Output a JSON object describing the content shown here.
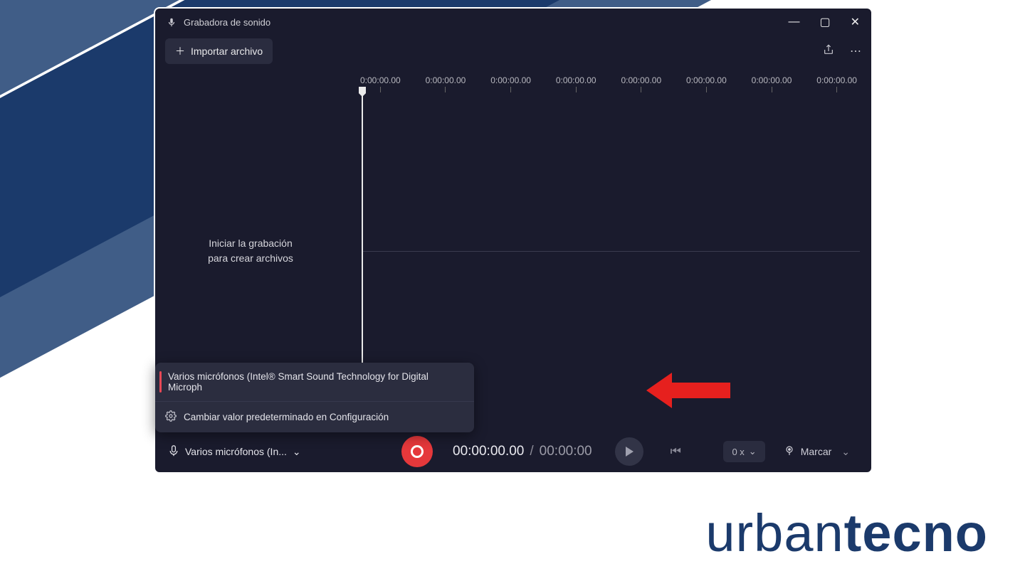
{
  "window": {
    "title": "Grabadora de sonido"
  },
  "toolbar": {
    "import_label": "Importar archivo"
  },
  "sidebar": {
    "hint_line1": "Iniciar la grabación",
    "hint_line2": "para crear archivos"
  },
  "ruler": [
    "0:00:00.00",
    "0:00:00.00",
    "0:00:00.00",
    "0:00:00.00",
    "0:00:00.00",
    "0:00:00.00",
    "0:00:00.00",
    "0:00:00.00"
  ],
  "popup": {
    "option_label": "Varios micrófonos (Intel® Smart Sound Technology for Digital Microph",
    "settings_label": "Cambiar valor predeterminado en Configuración"
  },
  "controls": {
    "mic_label": "Varios micrófonos (In...",
    "time_current": "00:00:00.00",
    "time_total": "00:00:00",
    "speed_label": "0 x",
    "mark_label": "Marcar"
  },
  "brand": {
    "a": "urban",
    "b": "tecno"
  }
}
